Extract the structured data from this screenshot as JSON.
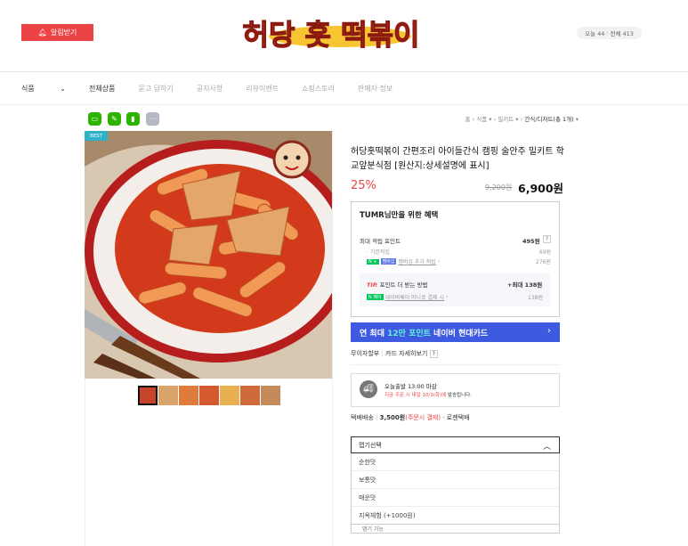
{
  "header": {
    "alarm_label": "알림받기",
    "logo_text": "허당 홋 떡볶이",
    "visit_today": "오늘 44",
    "visit_sep": "·",
    "visit_total": "전체 413"
  },
  "nav": {
    "items": [
      "식품",
      "전체상품",
      "묻고 답하기",
      "공지사항",
      "리뷰이벤트",
      "쇼핑스토리",
      "판매자 정보"
    ]
  },
  "breadcrumb": {
    "home": "홈",
    "c1": "식품",
    "c2": "밀키트",
    "c3": "간식/디저트(총 1개)",
    "sep": "›"
  },
  "product": {
    "badge": "BEST",
    "title": "허당홋떡볶이 간편조리 아이들간식 캠핑 술안주 밀키트 학교앞분식점 [원산지:상세설명에 표시]",
    "discount": "25%",
    "original_price": "9,200원",
    "price": "6,900원"
  },
  "benefit": {
    "title": "TUMR님만을 위한 혜택",
    "max_points_label": "최대 적립 포인트",
    "max_points_value": "495원",
    "basic_label": "기본적립",
    "basic_value": "69원",
    "membership_label": "멤버십 추가 적립",
    "membership_value": "276원",
    "tip_label": "TIP.",
    "tip_text": "포인트 더 받는 방법",
    "tip_value": "+최대 138원",
    "naverpay_label": "네이버페이 머니로 결제 시",
    "naverpay_value": "138원"
  },
  "card_banner": {
    "prefix": "연 최대 ",
    "highlight": "12만 포인트",
    "suffix": " 네이버 현대카드"
  },
  "installment": {
    "label": "무이자할부",
    "link": "카드 자세히보기"
  },
  "shipping": {
    "line1": "오늘출발 13:00 마감",
    "line2_red": "지금 주문 시 내일 10/1(화)에",
    "line2_rest": " 발송됩니다."
  },
  "delivery": {
    "label": "택배배송",
    "price": "3,500원",
    "paren": "(주문시 결제)",
    "carrier": "· 로젠택배"
  },
  "option": {
    "placeholder": "맵기선택",
    "items": [
      "순한맛",
      "보통맛",
      "매운맛",
      "지옥체험 (+1000원)"
    ],
    "peek": "맵기 가능"
  },
  "colors": {
    "accent_red": "#ec4446",
    "card_blue": "#3e5ae0",
    "naver_green": "#03c75a"
  }
}
